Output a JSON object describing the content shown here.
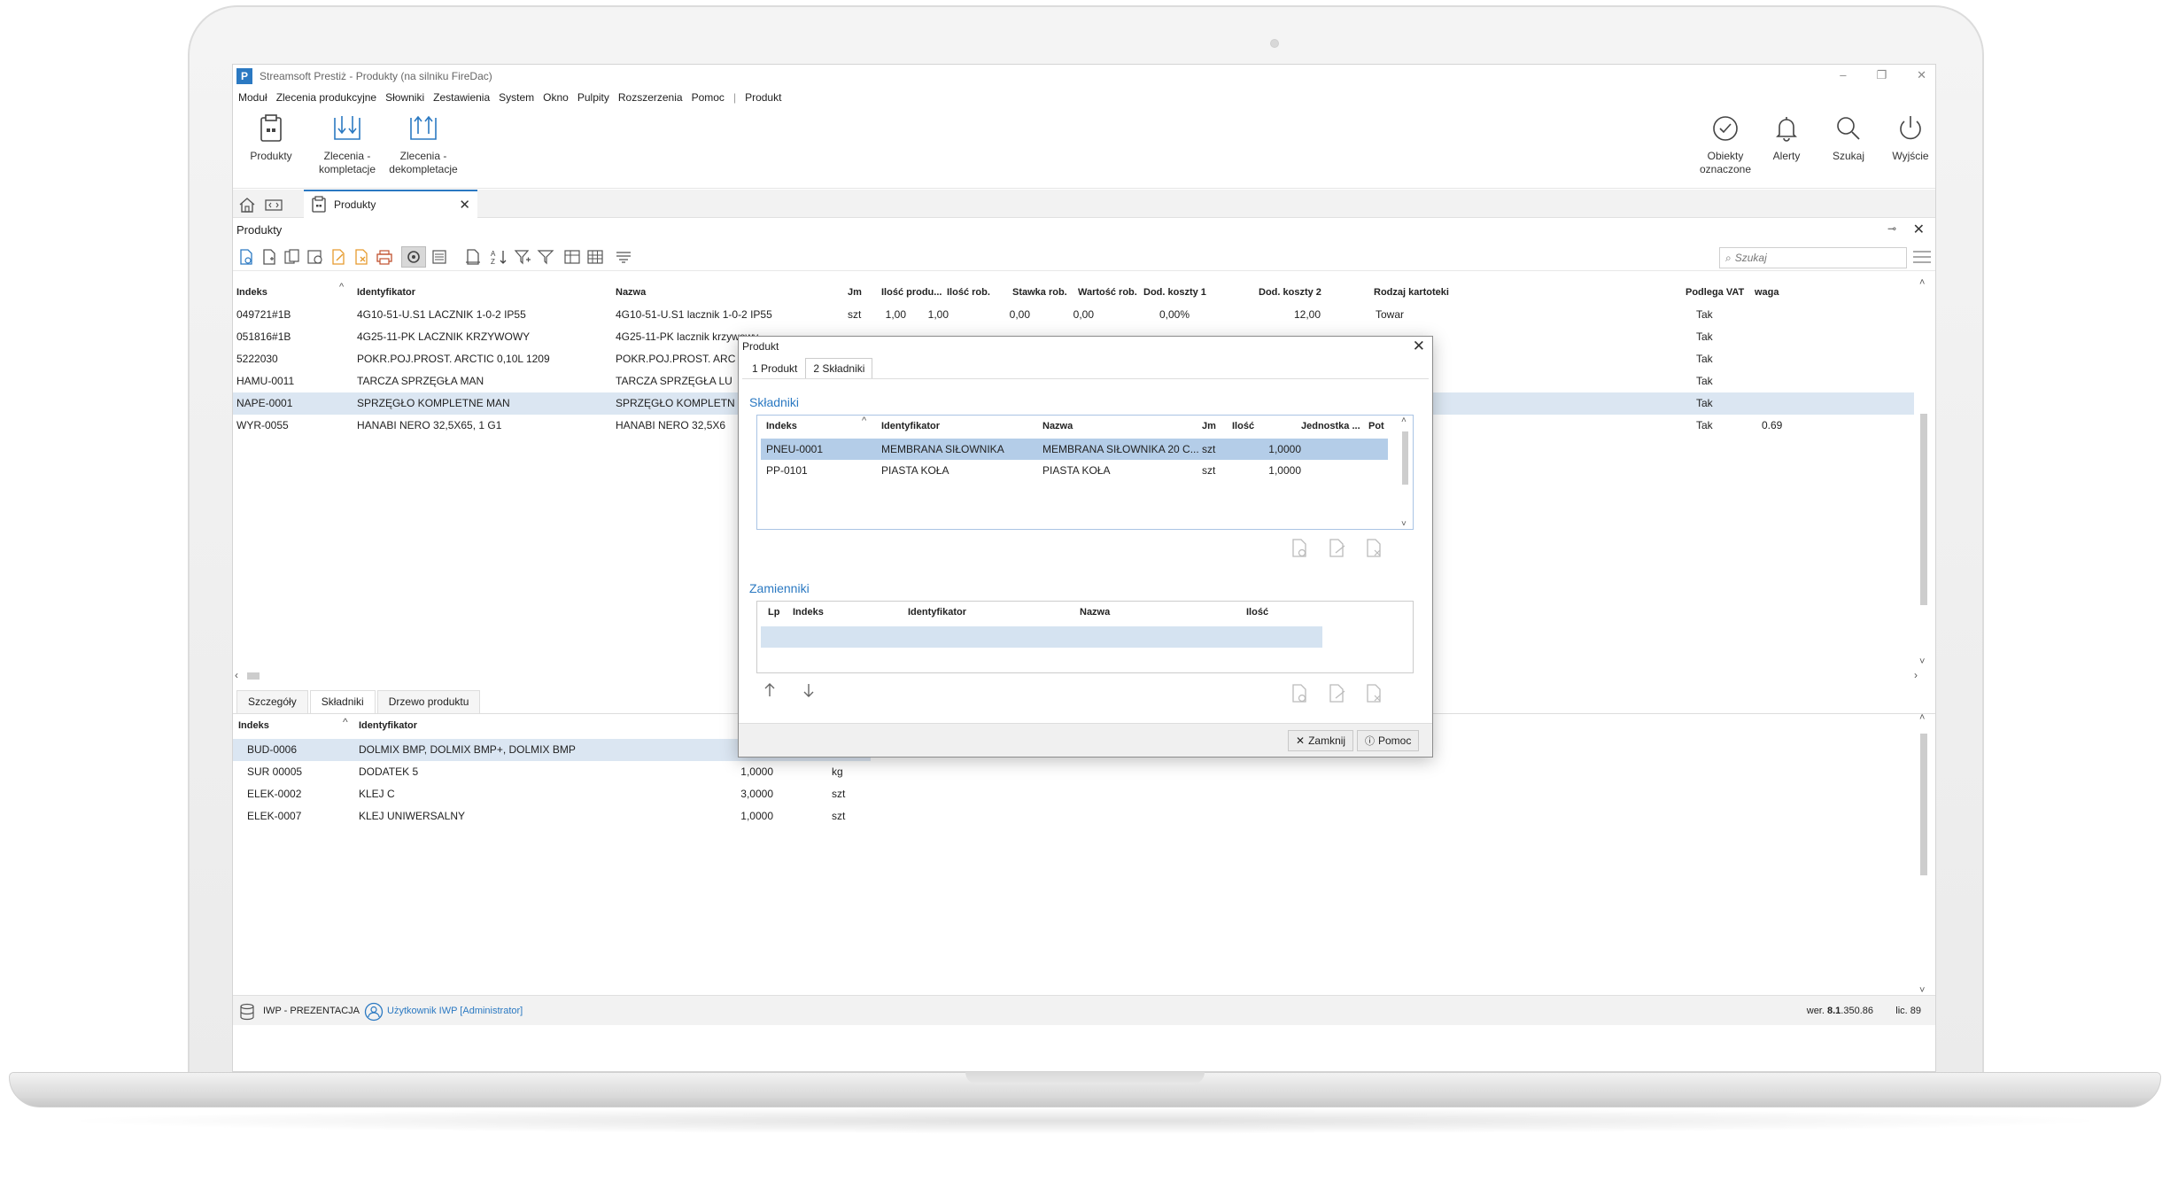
{
  "window": {
    "title": "Streamsoft Prestiż - Produkty (na silniku FireDac)",
    "logo_letter": "P",
    "controls": [
      "–",
      "❐",
      "✕"
    ]
  },
  "menu": [
    "Moduł",
    "Zlecenia produkcyjne",
    "Słowniki",
    "Zestawienia",
    "System",
    "Okno",
    "Pulpity",
    "Rozszerzenia",
    "Pomoc",
    "|",
    "Produkt"
  ],
  "ribbon": {
    "left": [
      {
        "label": "Produkty",
        "icon": "products-icon"
      },
      {
        "label": "Zlecenia - kompletacje",
        "icon": "assembly-orders-icon"
      },
      {
        "label": "Zlecenia - dekompletacje",
        "icon": "disassembly-orders-icon"
      }
    ],
    "right": [
      {
        "label": "Obiekty oznaczone",
        "icon": "check-circle-icon"
      },
      {
        "label": "Alerty",
        "icon": "bell-icon"
      },
      {
        "label": "Szukaj",
        "icon": "search-icon"
      },
      {
        "label": "Wyjście",
        "icon": "power-icon"
      }
    ]
  },
  "doc_tab": {
    "label": "Produkty"
  },
  "panel": {
    "title": "Produkty"
  },
  "search": {
    "placeholder": "Szukaj"
  },
  "main_grid": {
    "columns": [
      "Indeks",
      "Identyfikator",
      "Nazwa",
      "Jm",
      "Ilość produ...",
      "Ilość rob.",
      "Stawka rob.",
      "Wartość rob.",
      "Dod. koszty 1",
      "Dod. koszty 2",
      "Rodzaj kartoteki",
      "Podlega VAT",
      "waga"
    ],
    "rows": [
      {
        "indeks": "049721#1B",
        "identyfikator": "4G10-51-U.S1 LACZNIK 1-0-2   IP55",
        "nazwa": "4G10-51-U.S1 lacznik 1-0-2   IP55",
        "jm": "szt",
        "ilosc_prod": "1,00",
        "ilosc_rob": "1,00",
        "stawka": "0,00",
        "wartosc": "0,00",
        "dod1": "0,00%",
        "dod2": "12,00",
        "rodzaj": "Towar",
        "vat": "Tak",
        "waga": ""
      },
      {
        "indeks": "051816#1B",
        "identyfikator": "4G25-11-PK LACZNIK KRZYWOWY",
        "nazwa": "4G25-11-PK lacznik krzywowy",
        "jm": "",
        "ilosc_prod": "",
        "ilosc_rob": "",
        "stawka": "",
        "wartosc": "",
        "dod1": "",
        "dod2": "",
        "rodzaj": "",
        "vat": "Tak",
        "waga": ""
      },
      {
        "indeks": "5222030",
        "identyfikator": "POKR.POJ.PROST. ARCTIC 0,10L 1209",
        "nazwa": "POKR.POJ.PROST. ARC",
        "jm": "",
        "ilosc_prod": "",
        "ilosc_rob": "",
        "stawka": "",
        "wartosc": "",
        "dod1": "",
        "dod2": "",
        "rodzaj": "",
        "vat": "Tak",
        "waga": ""
      },
      {
        "indeks": "HAMU-0011",
        "identyfikator": "TARCZA SPRZĘGŁA MAN",
        "nazwa": "TARCZA SPRZĘGŁA LU",
        "jm": "",
        "ilosc_prod": "",
        "ilosc_rob": "",
        "stawka": "",
        "wartosc": "",
        "dod1": "",
        "dod2": "",
        "rodzaj": "",
        "vat": "Tak",
        "waga": ""
      },
      {
        "indeks": "NAPE-0001",
        "identyfikator": "SPRZĘGŁO KOMPLETNE MAN",
        "nazwa": "SPRZĘGŁO KOMPLETN",
        "jm": "",
        "ilosc_prod": "",
        "ilosc_rob": "",
        "stawka": "",
        "wartosc": "",
        "dod1": "",
        "dod2": "",
        "rodzaj": "",
        "vat": "Tak",
        "waga": ""
      },
      {
        "indeks": "WYR-0055",
        "identyfikator": "HANABI NERO 32,5X65, 1 G1",
        "nazwa": "HANABI NERO 32,5X6",
        "jm": "",
        "ilosc_prod": "",
        "ilosc_rob": "",
        "stawka": "",
        "wartosc": "",
        "dod1": "",
        "dod2": "",
        "rodzaj": "",
        "vat": "Tak",
        "waga": "0.69"
      }
    ],
    "selected_row": 4
  },
  "lower_tabs": [
    "Szczegóły",
    "Składniki",
    "Drzewo produktu"
  ],
  "lower_grid": {
    "columns": [
      "Indeks",
      "Identyfikator"
    ],
    "rows": [
      {
        "indeks": "BUD-0006",
        "identyfikator": "DOLMIX BMP, DOLMIX BMP+, DOLMIX BMP",
        "ilosc": "",
        "jm": ""
      },
      {
        "indeks": "SUR 00005",
        "identyfikator": "DODATEK 5",
        "ilosc": "1,0000",
        "jm": "kg"
      },
      {
        "indeks": "ELEK-0002",
        "identyfikator": "KLEJ C",
        "ilosc": "3,0000",
        "jm": "szt"
      },
      {
        "indeks": "ELEK-0007",
        "identyfikator": "KLEJ UNIWERSALNY",
        "ilosc": "1,0000",
        "jm": "szt"
      }
    ]
  },
  "status": {
    "db": "IWP - PREZENTACJA",
    "user": "Użytkownik IWP [Administrator]",
    "version_prefix": "wer.",
    "version_bold": "8.1",
    "version_rest": ".350.86",
    "license": "lic. 89"
  },
  "modal": {
    "title": "Produkt",
    "tabs": [
      "1 Produkt",
      "2 Składniki"
    ],
    "active_tab": 1,
    "section1": "Składniki",
    "grid1": {
      "columns": [
        "Indeks",
        "Identyfikator",
        "Nazwa",
        "Jm",
        "Ilość",
        "Jednostka ...",
        "Pot"
      ],
      "rows": [
        {
          "indeks": "PNEU-0001",
          "identyfikator": "MEMBRANA SIŁOWNIKA",
          "nazwa": "MEMBRANA SIŁOWNIKA 20 C...",
          "jm": "szt",
          "ilosc": "1,0000"
        },
        {
          "indeks": "PP-0101",
          "identyfikator": "PIASTA KOŁA",
          "nazwa": "PIASTA KOŁA",
          "jm": "szt",
          "ilosc": "1,0000"
        }
      ]
    },
    "section2": "Zamienniki",
    "grid2": {
      "columns": [
        "Lp",
        "Indeks",
        "Identyfikator",
        "Nazwa",
        "Ilość"
      ]
    },
    "buttons": {
      "close": "Zamknij",
      "help": "Pomoc"
    }
  }
}
